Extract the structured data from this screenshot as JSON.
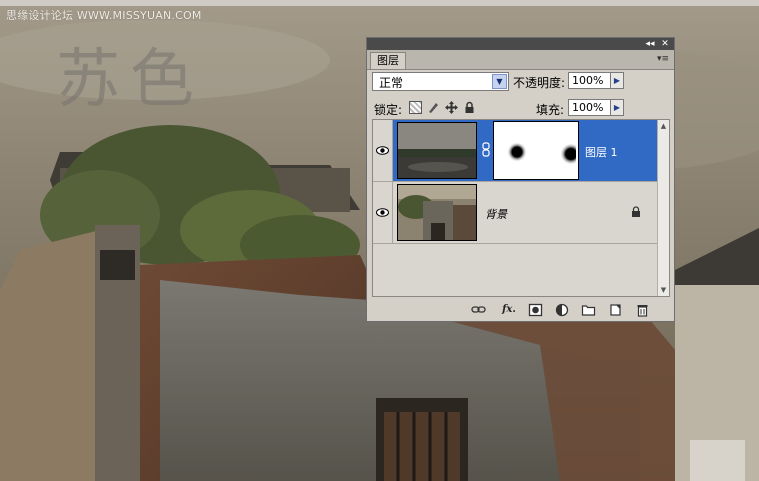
{
  "watermark": "思缘设计论坛 WWW.MISSYUAN.COM",
  "image_title": "苏色",
  "panel": {
    "window_buttons": [
      "◂◂",
      "✕"
    ],
    "tab_label": "图层",
    "menu_icon": "panel-menu-icon",
    "blend_mode": "正常",
    "opacity_label": "不透明度:",
    "opacity_value": "100%",
    "lock_label": "锁定:",
    "fill_label": "填充:",
    "fill_value": "100%",
    "layers": [
      {
        "name": "图层 1",
        "selected": true,
        "visible": true,
        "has_mask": true
      },
      {
        "name": "背景",
        "selected": false,
        "visible": true,
        "locked": true
      }
    ],
    "bottom_icons": [
      "link-layers-icon",
      "fx-icon",
      "add-mask-icon",
      "adjustment-layer-icon",
      "new-group-icon",
      "new-layer-icon",
      "delete-layer-icon"
    ],
    "fx_label": "fx."
  },
  "colors": {
    "selection": "#316ac5",
    "panel_bg": "#d4d0c8"
  }
}
